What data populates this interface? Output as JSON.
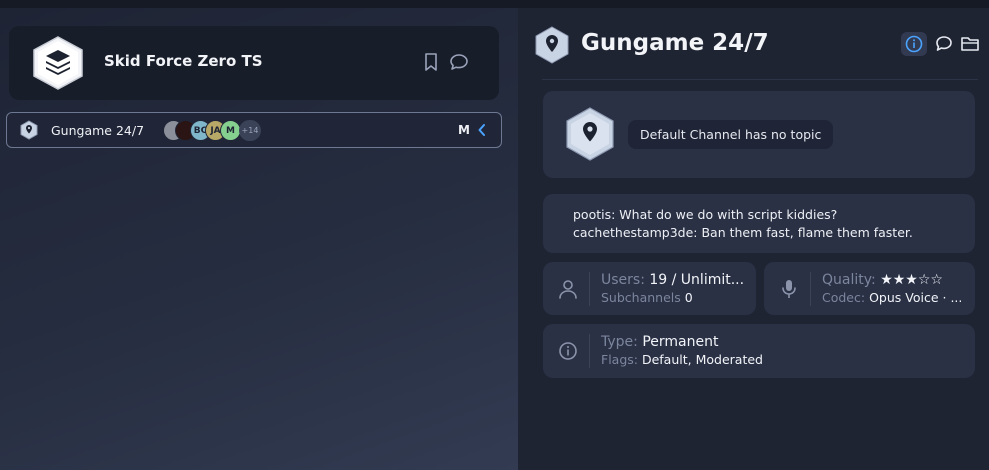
{
  "server": {
    "name": "Skid Force Zero TS"
  },
  "channel_list": {
    "items": [
      {
        "name": "Gungame 24/7",
        "avatars": [
          {
            "label": "",
            "color": "#8a8f99"
          },
          {
            "label": "",
            "color": "#2a1414"
          },
          {
            "label": "BC",
            "color": "#7fb6c9"
          },
          {
            "label": "JA",
            "color": "#b8a867"
          },
          {
            "label": "M",
            "color": "#86d08f"
          }
        ],
        "more_count": "+14",
        "mode_letter": "M"
      }
    ]
  },
  "channel_detail": {
    "title": "Gungame 24/7",
    "topic": "Default Channel has no topic",
    "messages": [
      "pootis: What do we do with script kiddies?",
      "cachethestamp3de: Ban them fast, flame them faster."
    ],
    "users_label": "Users:",
    "users_value": "19 / Unlimit...",
    "subchannels_label": "Subchannels",
    "subchannels_value": "0",
    "quality_label": "Quality:",
    "quality_value": "★★★☆☆",
    "codec_label": "Codec:",
    "codec_value": "Opus Voice · ...",
    "type_label": "Type:",
    "type_value": "Permanent",
    "flags_label": "Flags:",
    "flags_value": "Default, Moderated"
  },
  "colors": {
    "accent": "#4aa3ff",
    "background": "#1f2433",
    "card": "#2a3145"
  }
}
